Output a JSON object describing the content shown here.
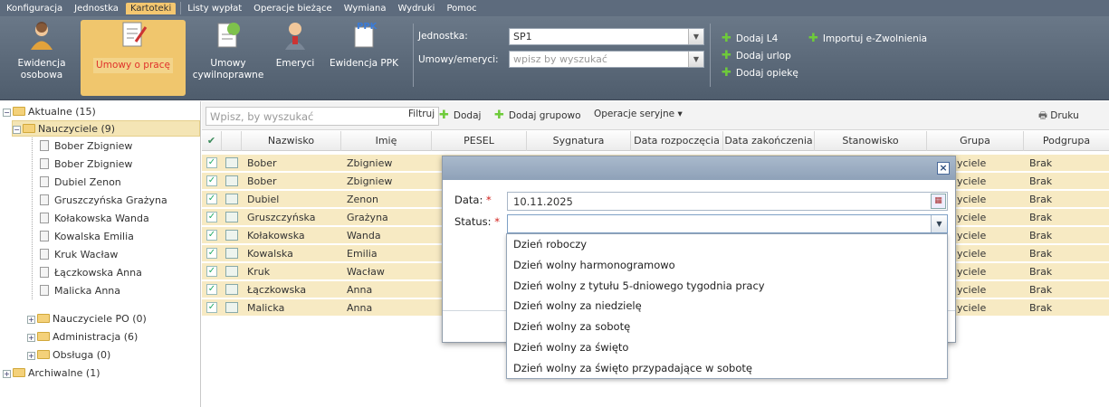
{
  "menu": [
    "Konfiguracja",
    "Jednostka",
    "Kartoteki",
    "Listy wypłat",
    "Operacje bieżące",
    "Wymiana",
    "Wydruki",
    "Pomoc"
  ],
  "menu_active": "Kartoteki",
  "ribbon": {
    "buttons": [
      {
        "label1": "Ewidencja",
        "label2": "osobowa"
      },
      {
        "label1": "Umowy o pracę",
        "label2": ""
      },
      {
        "label1": "Umowy",
        "label2": "cywilnoprawne"
      },
      {
        "label1": "Emeryci",
        "label2": ""
      },
      {
        "label1": "Ewidencja PPK",
        "label2": "",
        "badge": "PPK"
      }
    ],
    "jednostka_label": "Jednostka:",
    "jednostka_value": "SP1",
    "umowy_label": "Umowy/emeryci:",
    "umowy_placeholder": "wpisz by wyszukać",
    "links": [
      "Dodaj L4",
      "Dodaj urlop",
      "Dodaj opiekę",
      "Importuj e-Zwolnienia"
    ]
  },
  "tree": {
    "root": "Aktualne (15)",
    "group": "Nauczyciele (9)",
    "people": [
      "Bober Zbigniew",
      "Bober Zbigniew",
      "Dubiel Zenon",
      "Gruszczyńska Grażyna",
      "Kołakowska Wanda",
      "Kowalska Emilia",
      "Kruk Wacław",
      "Łączkowska Anna",
      "Malicka Anna"
    ],
    "other": [
      "Nauczyciele PO (0)",
      "Administracja (6)",
      "Obsługa (0)"
    ],
    "archive": "Archiwalne (1)"
  },
  "toolbar": {
    "search_placeholder": "Wpisz, by wyszukać",
    "filter": "Filtruj",
    "add": "Dodaj",
    "add_group": "Dodaj grupowo",
    "serial_ops": "Operacje seryjne ▾",
    "print": "Druku"
  },
  "columns": [
    "Nazwisko",
    "Imię",
    "PESEL",
    "Sygnatura",
    "Data rozpoczęcia",
    "Data zakończenia",
    "Stanowisko",
    "Grupa",
    "Podgrupa"
  ],
  "rows": [
    {
      "last": "Bober",
      "first": "Zbigniew",
      "group": "yciele",
      "sub": "Brak"
    },
    {
      "last": "Bober",
      "first": "Zbigniew",
      "group": "yciele",
      "sub": "Brak"
    },
    {
      "last": "Dubiel",
      "first": "Zenon",
      "group": "yciele",
      "sub": "Brak"
    },
    {
      "last": "Gruszczyńska",
      "first": "Grażyna",
      "group": "yciele",
      "sub": "Brak"
    },
    {
      "last": "Kołakowska",
      "first": "Wanda",
      "group": "yciele",
      "sub": "Brak"
    },
    {
      "last": "Kowalska",
      "first": "Emilia",
      "group": "yciele",
      "sub": "Brak"
    },
    {
      "last": "Kruk",
      "first": "Wacław",
      "group": "yciele",
      "sub": "Brak"
    },
    {
      "last": "Łączkowska",
      "first": "Anna",
      "group": "yciele",
      "sub": "Brak"
    },
    {
      "last": "Malicka",
      "first": "Anna",
      "group": "yciele",
      "sub": "Brak"
    }
  ],
  "dialog": {
    "date_label": "Data:",
    "date_value": "10.11.2025",
    "status_label": "Status:",
    "required_mark": "*"
  },
  "status_options": [
    "Dzień roboczy",
    "Dzień wolny harmonogramowo",
    "Dzień wolny z tytułu 5-dniowego tygodnia pracy",
    "Dzień wolny za niedzielę",
    "Dzień wolny za sobotę",
    "Dzień wolny za święto",
    "Dzień wolny za święto przypadające w sobotę"
  ]
}
